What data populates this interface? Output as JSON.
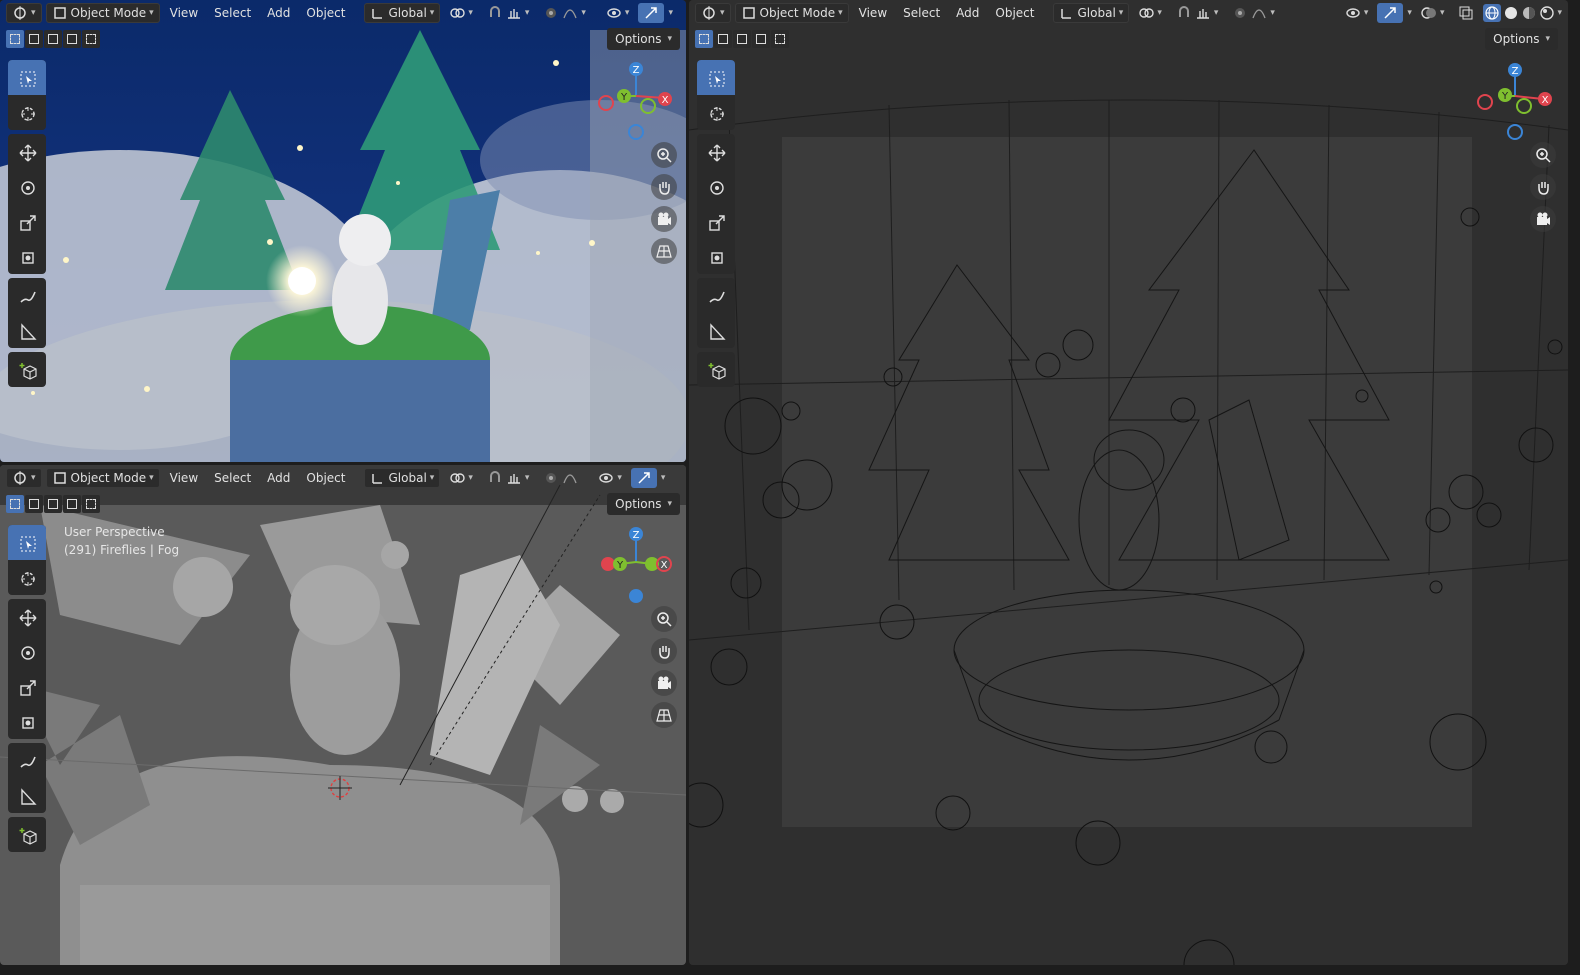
{
  "header": {
    "mode_label": "Object Mode",
    "menus": [
      "View",
      "Select",
      "Add",
      "Object"
    ],
    "transform_orientation": "Global",
    "options_label": "Options"
  },
  "viewport_bl": {
    "overlay_line1": "User Perspective",
    "overlay_line2": "(291) Fireflies | Fog"
  },
  "gizmo_axes": {
    "x": "X",
    "y": "Y",
    "z": "Z"
  },
  "colors": {
    "accent": "#4772b3",
    "axis_x": "#e0444e",
    "axis_y": "#7fbf2f",
    "axis_z": "#3b85d6",
    "panel_bg": "#303030"
  },
  "icons": [
    "editor-type-icon",
    "object-mode-icon",
    "transform-orientation-icon",
    "pivot-icon",
    "snap-icon",
    "proportional-edit-icon",
    "visibility-icon",
    "gizmo-toggle-icon",
    "overlay-icon",
    "xray-icon",
    "shading-wireframe-icon",
    "shading-solid-icon",
    "shading-material-icon",
    "shading-rendered-icon",
    "select-box-icon",
    "cursor-icon",
    "move-icon",
    "rotate-icon",
    "scale-icon",
    "transform-icon",
    "annotate-icon",
    "measure-icon",
    "add-cube-icon",
    "zoom-icon",
    "pan-hand-icon",
    "camera-icon",
    "grid-perspective-icon"
  ]
}
